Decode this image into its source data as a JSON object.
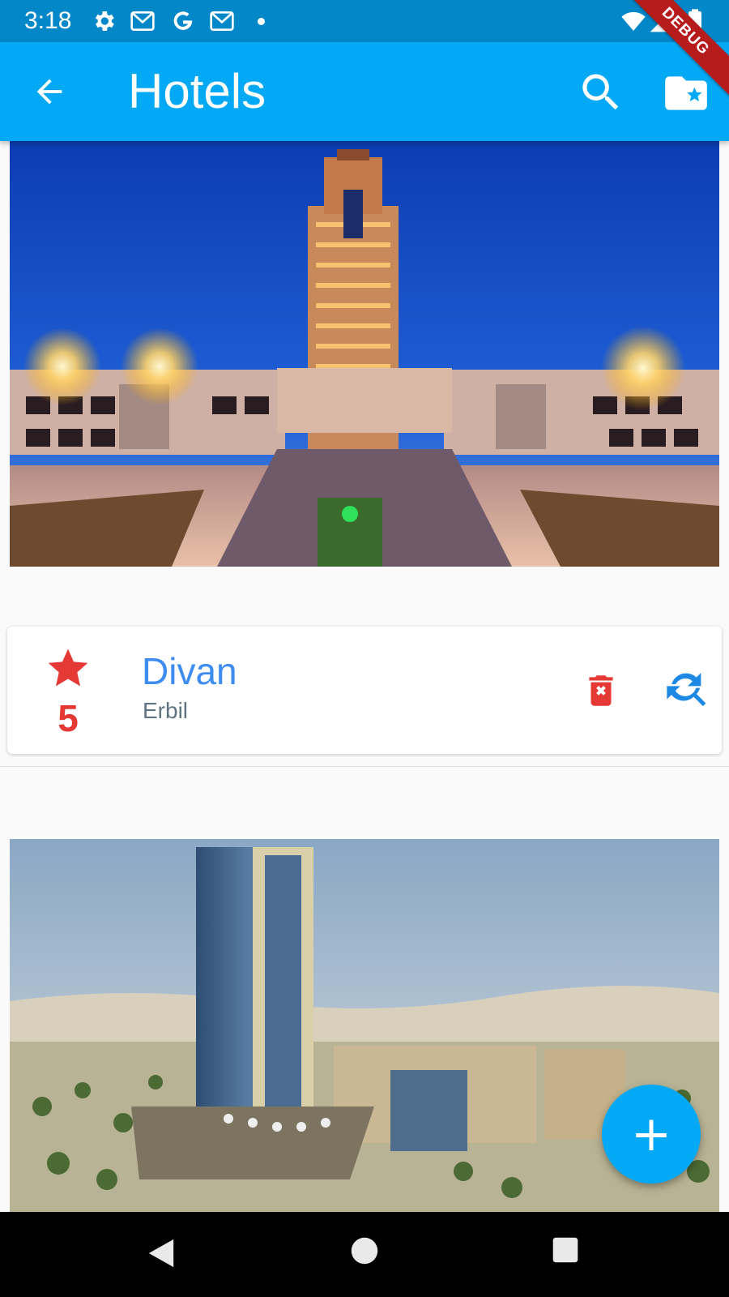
{
  "status_bar": {
    "time": "3:18",
    "icons": [
      "settings-icon",
      "gmail-icon",
      "google-icon",
      "gmail-icon",
      "notification-dot",
      "wifi-icon",
      "signal-icon",
      "battery-icon"
    ]
  },
  "debug_banner": "DEBUG",
  "app_bar": {
    "title": "Hotels",
    "icons": [
      "back-arrow-icon",
      "search-icon",
      "starred-folder-icon"
    ]
  },
  "hotels": [
    {
      "name": "Divan",
      "city": "Erbil",
      "stars": "5",
      "image": "divan-hotel-night-photo"
    },
    {
      "image": "hotel-tower-daytime-photo"
    }
  ],
  "card_actions": [
    "delete-icon",
    "refresh-search-icon"
  ],
  "fab": {
    "label": "+"
  },
  "nav_bar": [
    "back-nav-icon",
    "home-nav-icon",
    "recents-nav-icon"
  ],
  "colors": {
    "status_bar": "#0288c9",
    "app_bar": "#03a9f4",
    "accent_red": "#e53935",
    "name_blue": "#3d8cf0",
    "debug": "#b71c1c"
  }
}
